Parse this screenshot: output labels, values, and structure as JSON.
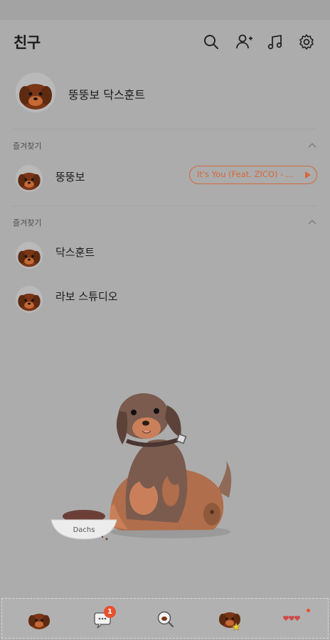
{
  "header": {
    "title": "친구"
  },
  "header_icons": [
    "search-icon",
    "add-friend-icon",
    "music-icon",
    "settings-icon"
  ],
  "my_profile": {
    "name": "뚱뚱보 닥스훈트"
  },
  "sections": [
    {
      "label": "즐겨찾기"
    },
    {
      "label": "즐겨찾기"
    }
  ],
  "favorites": [
    {
      "name": "뚱뚱보",
      "music": "It's You (Feat. ZICO) - ..."
    }
  ],
  "friends": [
    {
      "name": "닥스훈트"
    },
    {
      "name": "라보 스튜디오"
    }
  ],
  "illustration": {
    "bowl_label": "Dachs"
  },
  "bottom_nav": {
    "chat_badge": "1"
  },
  "colors": {
    "accent": "#d4683a",
    "badge": "#e8502e",
    "background": "#acacac"
  }
}
